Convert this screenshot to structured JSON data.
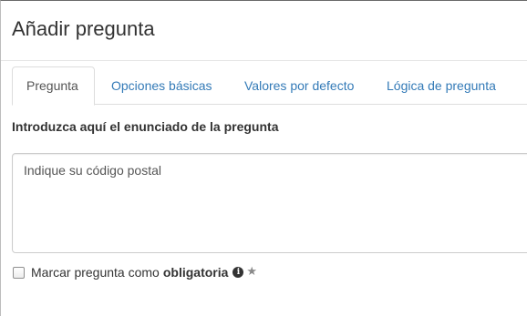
{
  "dialog": {
    "title": "Añadir pregunta"
  },
  "tabs": [
    {
      "label": "Pregunta",
      "active": true
    },
    {
      "label": "Opciones básicas",
      "active": false
    },
    {
      "label": "Valores por defecto",
      "active": false
    },
    {
      "label": "Lógica de pregunta",
      "active": false
    }
  ],
  "question": {
    "label": "Introduzca aquí el enunciado de la pregunta",
    "value": "Indique su código postal"
  },
  "required": {
    "checked": false,
    "label_prefix": "Marcar pregunta como",
    "label_bold": "obligatoria",
    "info_icon": "info-circle-icon",
    "star_icon": "star-icon"
  },
  "colors": {
    "link": "#337ab7",
    "text": "#333333",
    "border": "#dddddd"
  }
}
